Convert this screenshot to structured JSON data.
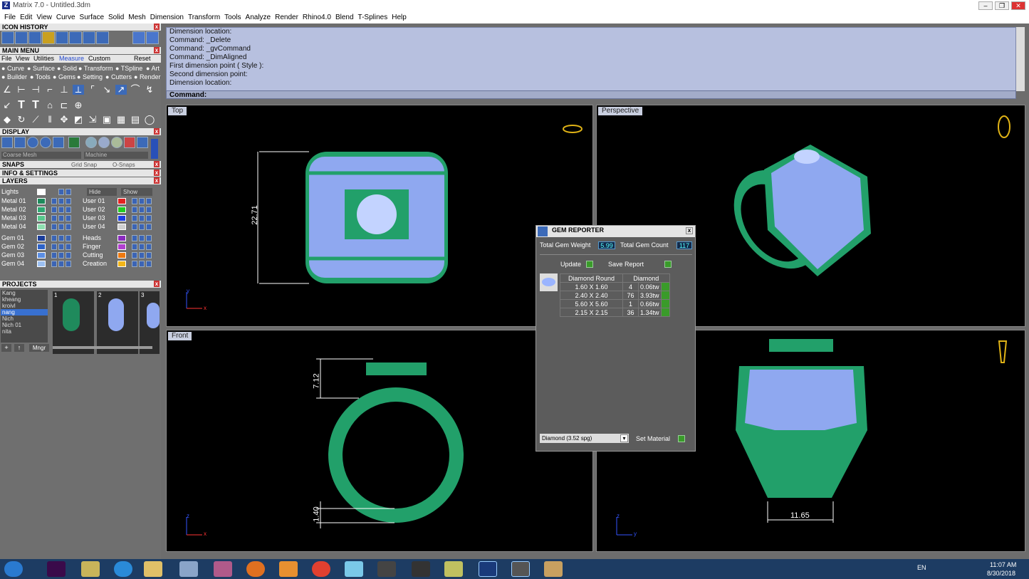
{
  "window": {
    "title": "Matrix 7.0 - Untitled.3dm",
    "logo": "Z"
  },
  "menu": [
    "File",
    "Edit",
    "View",
    "Curve",
    "Surface",
    "Solid",
    "Mesh",
    "Dimension",
    "Transform",
    "Tools",
    "Analyze",
    "Render",
    "Rhino4.0",
    "Blend",
    "T-Splines",
    "Help"
  ],
  "panels": {
    "icon_history": "ICON HISTORY",
    "main_menu": "MAIN MENU",
    "main_menu_tabs": [
      "File",
      "View",
      "Utilities",
      "Measure",
      "Custom",
      "Reset"
    ],
    "categories_row1": [
      "Curve",
      "Surface",
      "Solid",
      "Transform",
      "TSpline",
      "Art"
    ],
    "categories_row2": [
      "Builder",
      "Tools",
      "Gems",
      "Setting",
      "Cutters",
      "Render"
    ],
    "display": "DISPLAY",
    "mesh_select": "Coarse Mesh",
    "machine_select": "Machine",
    "snaps": "SNAPS",
    "grid_snap": "Grid Snap",
    "o_snaps": "O-Snaps",
    "info_settings": "INFO & SETTINGS",
    "layers": "LAYERS",
    "lights": "Lights",
    "hide": "Hide",
    "show": "Show",
    "layers_left": [
      "Metal 01",
      "Metal 02",
      "Metal 03",
      "Metal 04",
      "Gem 01",
      "Gem 02",
      "Gem 03",
      "Gem 04"
    ],
    "layers_right": [
      "User 01",
      "User 02",
      "User 03",
      "User 04",
      "Heads",
      "Finger",
      "Cutting",
      "Creation"
    ],
    "layer_colors_left": [
      "#1f8a5c",
      "#2fa872",
      "#57c88c",
      "#8ee0b0",
      "#1b3d9b",
      "#2d62c8",
      "#5b8ee3",
      "#9cc0f2"
    ],
    "layer_colors_right": [
      "#e32222",
      "#22cc22",
      "#1d3ee6",
      "#d0d0d0",
      "#8a2bbf",
      "#b23fd0",
      "#ee7a11",
      "#f3b619"
    ],
    "projects": "PROJECTS",
    "project_list": [
      "Kang",
      "kheang",
      "kroivl",
      "nang",
      "Nich",
      "Nich 01",
      "nita"
    ],
    "project_thumbs": [
      "1",
      "2",
      "3"
    ],
    "mngr": "Mngr"
  },
  "command_history": [
    "Dimension location:",
    "Command: _Delete",
    "Command: _gvCommand",
    "Command: _DimAligned",
    "First dimension point ( Style ):",
    "Second dimension point:",
    "Dimension location:"
  ],
  "command_prompt": "Command:",
  "viewports": {
    "top": {
      "label": "Top",
      "dimension": "22.71",
      "axis_x": "x",
      "axis_y": "y"
    },
    "perspective": {
      "label": "Perspective"
    },
    "front": {
      "label": "Front",
      "dim_top": "7.12",
      "dim_bottom": "1.40",
      "axis_x": "x",
      "axis_y": "z"
    },
    "right": {
      "dimension": "11.65",
      "axis_x": "y",
      "axis_y": "z"
    }
  },
  "gem_reporter": {
    "title": "GEM REPORTER",
    "total_weight_label": "Total Gem Weight",
    "total_weight": "5.99",
    "total_count_label": "Total Gem Count",
    "total_count": "117",
    "update": "Update",
    "save_report": "Save Report",
    "table_headers": [
      "Diamond Round",
      "Diamond"
    ],
    "rows": [
      {
        "size": "1.60 X 1.60",
        "count": "4",
        "weight": "0.06tw"
      },
      {
        "size": "2.40 X 2.40",
        "count": "76",
        "weight": "3.93tw"
      },
      {
        "size": "5.60 X 5.60",
        "count": "1",
        "weight": "0.66tw"
      },
      {
        "size": "2.15 X 2.15",
        "count": "36",
        "weight": "1.34tw"
      }
    ],
    "material": "Diamond   (3.52 spg)",
    "set_material": "Set Material"
  },
  "tray": {
    "lang": "EN",
    "time": "11:07 AM",
    "date": "8/30/2018"
  },
  "taskbar_apps": [
    "windows-start",
    "premiere",
    "files",
    "internet-explorer",
    "file-explorer",
    "calculator",
    "paint-tool",
    "firefox",
    "media-player",
    "chrome",
    "notes",
    "pen-tool",
    "zbrush",
    "sticky",
    "matrix",
    "rhino",
    "palette"
  ],
  "colors": {
    "metal": "#22a06a",
    "gem": "#8fa8f0",
    "prong": "#9b1fb0",
    "panel": "#6f6f6f",
    "command_bg": "#b7c0df"
  }
}
